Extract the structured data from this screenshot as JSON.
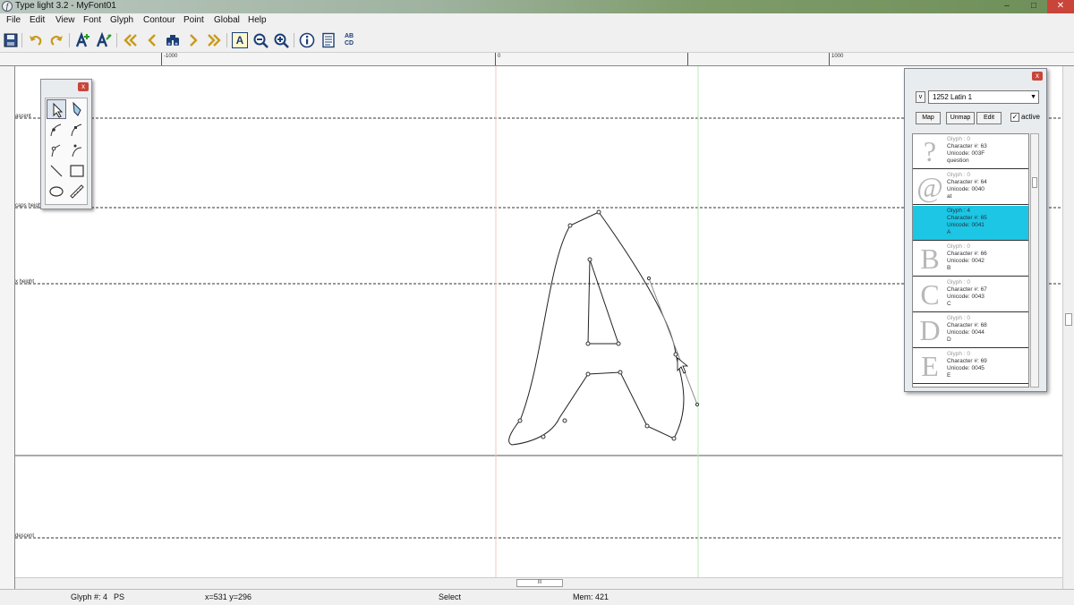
{
  "window": {
    "title": "Type light 3.2  -  MyFont01",
    "minimize": "–",
    "maximize": "□",
    "close": "✕"
  },
  "menu": [
    "File",
    "Edit",
    "View",
    "Font",
    "Glyph",
    "Contour",
    "Point",
    "Global",
    "Help"
  ],
  "toolbar": {
    "icons": [
      "save-icon",
      "undo-icon",
      "redo-icon",
      "add-glyph-icon",
      "edit-glyph-icon",
      "first-glyph-icon",
      "previous-glyph-icon",
      "find-glyph-icon",
      "next-glyph-icon",
      "last-glyph-icon",
      "preview-icon",
      "zoom-out-icon",
      "zoom-in-icon",
      "info-icon",
      "list-icon",
      "abcd-icon"
    ],
    "abcd_top": "AB",
    "abcd_bottom": "CD",
    "preview_letter": "A"
  },
  "ruler": {
    "labels": [
      "-1000",
      "0",
      "1000"
    ]
  },
  "metrics": {
    "ascent": "ascent",
    "cap_height": "caps height",
    "x_height": "x height",
    "descent": "descent"
  },
  "drawing_tools": {
    "close": "x",
    "tools": [
      "select-arrow-icon",
      "pen-icon",
      "curve-point-icon",
      "corner-point-icon",
      "tangent-point-icon",
      "smooth-point-icon",
      "line-icon",
      "rectangle-icon",
      "ellipse-icon",
      "ruler-icon"
    ]
  },
  "char_panel": {
    "close": "x",
    "small_button": "v",
    "codepage": "1252 Latin 1",
    "map_label": "Map",
    "unmap_label": "Unmap",
    "edit_label": "Edit",
    "active_label": "active",
    "active_checked": true,
    "items": [
      {
        "glyph_char": "?",
        "glyph": "Glyph : 0",
        "character": "Character #: 63",
        "unicode": "Unicode: 003F",
        "name": "question",
        "selected": false
      },
      {
        "glyph_char": "@",
        "glyph": "Glyph : 0",
        "character": "Character #: 64",
        "unicode": "Unicode: 0040",
        "name": "at",
        "selected": false
      },
      {
        "glyph_char": "",
        "glyph": "Glyph : 4",
        "character": "Character #: 65",
        "unicode": "Unicode: 0041",
        "name": "A",
        "selected": true
      },
      {
        "glyph_char": "B",
        "glyph": "Glyph : 0",
        "character": "Character #: 66",
        "unicode": "Unicode: 0042",
        "name": "B",
        "selected": false
      },
      {
        "glyph_char": "C",
        "glyph": "Glyph : 0",
        "character": "Character #: 67",
        "unicode": "Unicode: 0043",
        "name": "C",
        "selected": false
      },
      {
        "glyph_char": "D",
        "glyph": "Glyph : 0",
        "character": "Character #: 68",
        "unicode": "Unicode: 0044",
        "name": "D",
        "selected": false
      },
      {
        "glyph_char": "E",
        "glyph": "Glyph : 0",
        "character": "Character #: 69",
        "unicode": "Unicode: 0045",
        "name": "E",
        "selected": false
      }
    ]
  },
  "scrollbar": {
    "grip": "III"
  },
  "status": {
    "glyph": "Glyph #: 4",
    "format": "PS",
    "coords": "x=531  y=296",
    "mode": "Select",
    "memory": "Mem: 421"
  },
  "colors": {
    "selection": "#1cc6e4",
    "close_button": "#c9453a",
    "origin_line": "#f2c6c6",
    "advance_line": "#b9e8b9"
  }
}
